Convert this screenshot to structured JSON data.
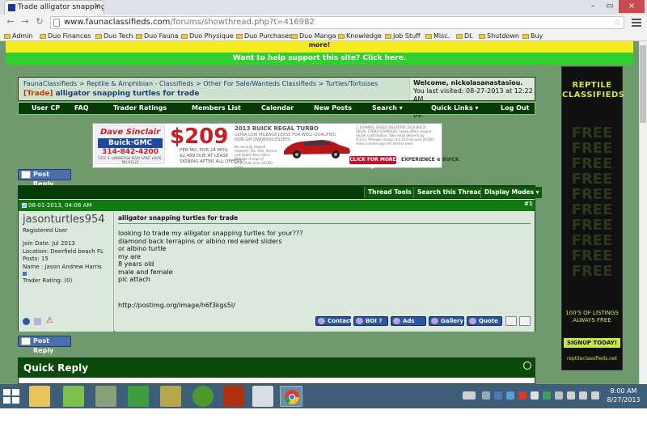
{
  "browser": {
    "tab_title": "Trade alligator snapping t",
    "tab_close": "×",
    "url_host": "www.faunaclassifieds.com",
    "url_path": "/forums/showthread.php?t=416982",
    "window_buttons": [
      "–",
      "▭",
      "×"
    ],
    "bookmarks": [
      "Admin",
      "Duo Finances",
      "Duo Tech",
      "Duo Fauna",
      "Duo Physique",
      "Duo Purchases",
      "Duo Manga",
      "Knowledge",
      "Job Stuff",
      "Misc.",
      "DL",
      "Shutdown",
      "Buy"
    ]
  },
  "banners": {
    "top_more": "more!",
    "support": "Want to help support this site? Click here."
  },
  "breadcrumb": {
    "path": "FaunaClassifieds > Reptile & Amphibian - Classifieds > Other For Sale/Wanteds Classifieds > Turtles/Tortoises",
    "tag": "[Trade]",
    "thread_title": "alligator snapping turtles for trade"
  },
  "welcome": {
    "greeting": "Welcome, nickolasanastasiou.",
    "last_visited": "You last visited: 08-27-2013 at 12:22 AM",
    "private_messages": "Private Messages: Unread 0, Total 89."
  },
  "navbar": [
    "User CP",
    "FAQ",
    "Trader Ratings",
    "Members List",
    "Calendar",
    "New Posts",
    "Search ▾",
    "Quick Links ▾",
    "Log Out"
  ],
  "ad": {
    "dealer_name": "Dave Sinclair",
    "dealer_brand": "Buick·GMC",
    "phone": "314-842-4200",
    "address": "5555 S. LINDBERGH BLVD SAINT LOUIS, MO 63123",
    "price": "$209",
    "terms": "PER MO. FOR 24 MOS.\n$2,499 DUE AT LEASE\nSIGNING AFTER ALL OFFERS",
    "headline": "2013 BUICK REGAL TURBO",
    "sub": "ULTRA LOW MILEAGE LEASE FOR WELL-QUALIFIED\nNON-GM OWNERS/LESSEES",
    "deposit_note": "No security deposit required. Tax, title, license and dealer fees extra. Mileage charge of $0.25/mile over 20,000 miles.",
    "fine_print": "1. EXAMPLE BASED ON ENTIRE 2013 BUICK REGAL TURBO EXAMPLES. Lease offers require dealer contribution. Take retail delivery by 9/3/13. Mileage charge of $.25/mile over 20,000 miles. Lessee pays for excess wear.",
    "cta": "CLICK FOR MORE ▸",
    "experience": "EXPERIENCE ⊕ BUICK"
  },
  "post_reply_label": "Post Reply",
  "thread_tools": [
    "Thread Tools ▾",
    "Search this Thread ▾",
    "Display Modes ▾"
  ],
  "post": {
    "date": "08-01-2013, 04:08 AM",
    "number": "#1",
    "username": "jasonturtles954",
    "user_title": "Registered User",
    "join_date": "Join Date: Jul 2013",
    "location": "Location: Deerfield beach FL",
    "posts": "Posts: 15",
    "name": "Name : Jason Andrew Harris",
    "trader_rating": "Trader Rating: (0)",
    "title": "alligator snapping turtles for trade",
    "body": "looking to trade my alligator snapping turtles for your???\ndiamond back terrapins or albino red eared sliders\nor albino turtle\nmy are\n8 years old\nmale and female\npic attach",
    "link": "http://postimg.org/image/h6f3kgs5l/",
    "buttons": [
      "Contact",
      "BOI ?",
      "Ads",
      "Gallery",
      "Quote"
    ]
  },
  "quick_reply": "Quick Reply",
  "side_ad": {
    "title": "REPTILE\nCLASSIFIEDS",
    "watermark": "FREE\nFREE\nFREE\nFREE\nFREE\nFREE\nFREE\nFREE\nFREE\nFREE",
    "count": "100'S OF LISTINGS\nALWAYS FREE",
    "signup": "SIGNUP TODAY!",
    "url": "reptileclassifieds.net"
  },
  "taskbar": {
    "time": "8:00 AM",
    "date": "8/27/2013"
  },
  "colors": {
    "forum_bg": "#6e9a6e",
    "navbar": "#063b06",
    "support_banner": "#2fd02f",
    "accent_lime": "#c8e84a"
  }
}
